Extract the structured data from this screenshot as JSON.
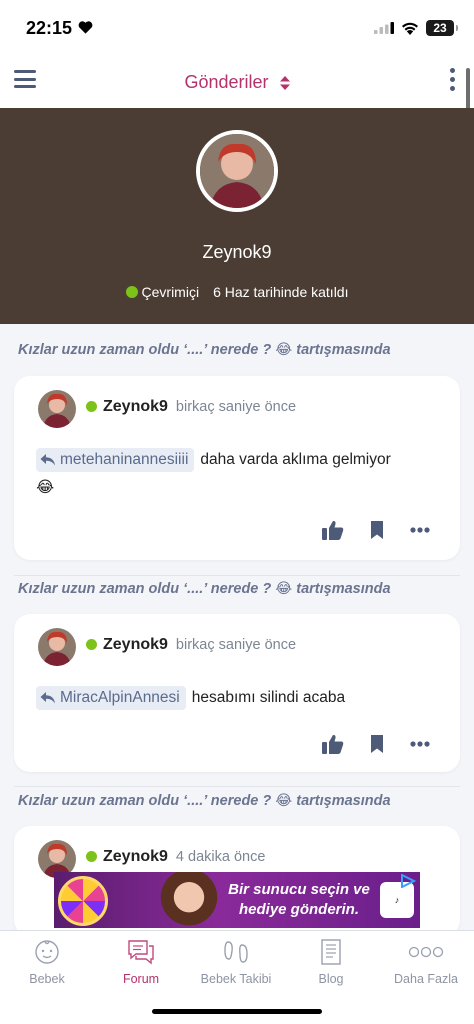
{
  "status_bar": {
    "time": "22:15",
    "battery": "23"
  },
  "header": {
    "title": "Gönderiler"
  },
  "profile": {
    "username": "Zeynok9",
    "status": "Çevrimiçi",
    "joined": "6 Haz tarihinde katıldı"
  },
  "posts": [
    {
      "thread_prefix": "Kızlar uzun zaman oldu ‘....’ nerede ?",
      "thread_emoji": "😂",
      "thread_suffix": "tartışmasında",
      "author": "Zeynok9",
      "time": "birkaç saniye önce",
      "mention": "metehaninannesiiii",
      "text": "daha varda aklıma gelmiyor",
      "trailing_emoji": "😂"
    },
    {
      "thread_prefix": "Kızlar uzun zaman oldu ‘....’ nerede ?",
      "thread_emoji": "😂",
      "thread_suffix": "tartışmasında",
      "author": "Zeynok9",
      "time": "birkaç saniye önce",
      "mention": "MiracAlpinAnnesi",
      "text": "hesabımı silindi acaba",
      "trailing_emoji": ""
    },
    {
      "thread_prefix": "Kızlar uzun zaman oldu ‘....’ nerede ?",
      "thread_emoji": "😂",
      "thread_suffix": "tartışmasında",
      "author": "Zeynok9",
      "time": "4 dakika önce"
    }
  ],
  "ad": {
    "text": "Bir sunucu seçin ve hediye gönderin."
  },
  "tabs": [
    {
      "label": "Bebek",
      "icon": "baby-face-icon",
      "active": false
    },
    {
      "label": "Forum",
      "icon": "chat-bubbles-icon",
      "active": true
    },
    {
      "label": "Bebek Takibi",
      "icon": "footprints-icon",
      "active": false
    },
    {
      "label": "Blog",
      "icon": "document-icon",
      "active": false
    },
    {
      "label": "Daha Fazla",
      "icon": "more-dots-icon",
      "active": false
    }
  ],
  "colors": {
    "accent": "#b5326d",
    "banner": "#4b3d33",
    "online": "#7cc21a",
    "icon": "#4d5a78"
  }
}
